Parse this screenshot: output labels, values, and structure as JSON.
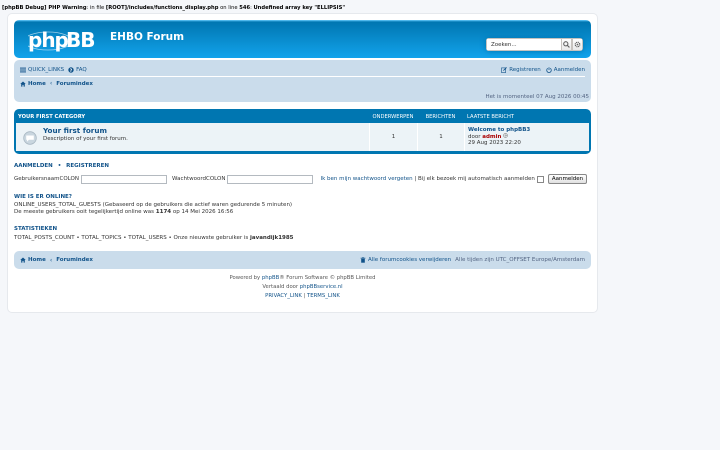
{
  "debug": {
    "prefix": "[phpBB Debug] PHP Warning",
    "mid1": ": in file ",
    "file": "[ROOT]/includes/functions_display.php",
    "mid2": " on line ",
    "line": "546",
    "mid3": ": ",
    "message": "Undefined array key \"ELLIPSIS\""
  },
  "header": {
    "site_title": "EHBO Forum",
    "search_placeholder": "Zoeken..."
  },
  "nav": {
    "quick_links": "QUICK_LINKS",
    "faq": "FAQ",
    "register": "Registreren",
    "login": "Aanmelden",
    "home": "Home",
    "forumindex": "Forumindex"
  },
  "time_text": "Het is momenteel 07 Aug 2026 00:45",
  "forum_table": {
    "category": "YOUR FIRST CATEGORY",
    "col_topics": "ONDERWERPEN",
    "col_posts": "BERICHTEN",
    "col_last": "LAATSTE BERICHT",
    "rows": [
      {
        "name": "Your first forum",
        "description": "Description of your first forum.",
        "topics": "1",
        "posts": "1",
        "last_title": "Welcome to phpBB3",
        "last_by_prefix": "door ",
        "last_author": "admin",
        "last_date": "29 Aug 2023 22:20"
      }
    ]
  },
  "login": {
    "heading_login": "AANMELDEN",
    "heading_sep": "•",
    "heading_register": "REGISTREREN",
    "username_label": "GebruikersnaamCOLON",
    "password_label": "WachtwoordCOLON",
    "forgot": "Ik ben mijn wachtwoord vergeten",
    "sep": " | ",
    "remember": "Bij elk bezoek mij automatisch aanmelden",
    "submit": "Aanmelden"
  },
  "online": {
    "heading": "WIE IS ER ONLINE?",
    "line1": "ONLINE_USERS_TOTAL_GUESTS (Gebaseerd op de gebruikers die actief waren gedurende 5 minuten)",
    "line2_pre": "De meeste gebruikers ooit tegelijkertijd online was ",
    "line2_count": "1174",
    "line2_post": " op 14 Mei 2026 16:56"
  },
  "stats": {
    "heading": "STATISTIEKEN",
    "line_pre": "TOTAL_POSTS_COUNT • TOTAL_TOPICS • TOTAL_USERS • Onze nieuwste gebruiker is ",
    "newest_user": "javandijk1985"
  },
  "footer": {
    "home": "Home",
    "forumindex": "Forumindex",
    "delete_cookies": "Alle forumcookies verwijderen",
    "timezone": "Alle tijden zijn UTC_OFFSET Europe/Amsterdam",
    "powered_pre": "Powered by ",
    "powered_link": "phpBB",
    "powered_post": "® Forum Software © phpBB Limited",
    "translated_pre": "Vertaald door ",
    "translated_link": "phpBBservice.nl",
    "privacy": "PRIVACY_LINK",
    "pipe": " | ",
    "terms": "TERMS_LINK"
  },
  "colors": {
    "header_blue": "#12a3eb",
    "nav_bg": "#cadceb",
    "link": "#105289",
    "admin_red": "#aa0000"
  }
}
